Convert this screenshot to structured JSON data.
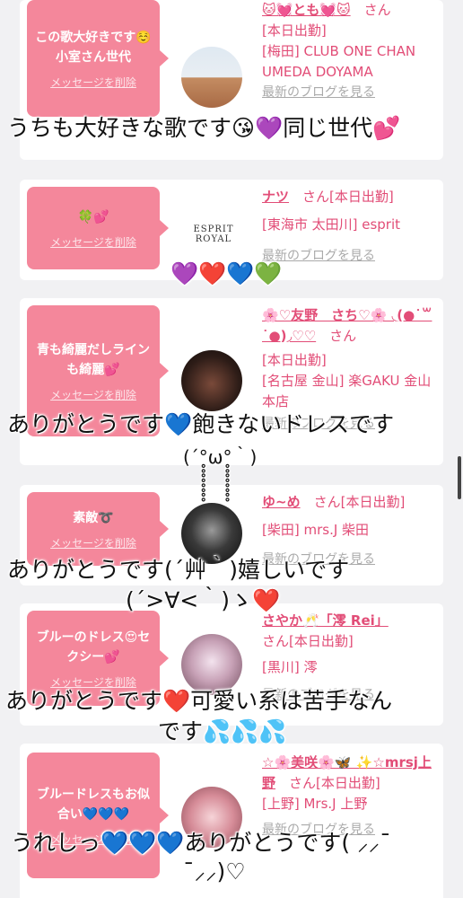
{
  "delete_label": "メッセージを削除",
  "blog_label": "最新のブログを見る",
  "san": "さん",
  "cards": [
    {
      "msg": "この歌大好きです☺️小室さん世代",
      "name": "🐱💓とも💓🐱",
      "status": "[本日出勤]",
      "shop": "[梅田] CLUB ONE CHAN UMEDA DOYAMA"
    },
    {
      "msg": "🍀💕",
      "name": "ナツ",
      "status": "[本日出勤]",
      "shop": "[東海市 太田川] esprit",
      "logo": "ESPRIT ROYAL"
    },
    {
      "msg": "青も綺麗だしラインも綺麗💕",
      "name": "🌸♡友野　さち♡🌸 ◟(●˙꒳˙●)◞♡♡",
      "status": "[本日出勤]",
      "shop": "[名古屋 金山] 楽GAKU 金山本店"
    },
    {
      "msg": "素敵➰",
      "name": "ゆ~め",
      "status": "[本日出勤]",
      "shop": "[柴田] mrs.J 柴田"
    },
    {
      "msg": "ブルーのドレス😍セクシー💕",
      "name": "さやか🥂「澪 Rei」",
      "status": "[本日出勤]",
      "shop": "[黒川] 澪"
    },
    {
      "msg": "ブルードレスもお似合い💙💙💙",
      "name": "☆🌸美咲🌸🦋 ✨☆mrsj上野",
      "status": "[本日出勤]",
      "shop": "[上野] Mrs.J 上野"
    }
  ],
  "replies": [
    "うちも大好きな歌です😘💜同じ世代💕",
    "💜❤️💙💚",
    "ありがとうです💙飽きないドレスです",
    "(´°̥̥̥̥̥̥̥̥ω°̥̥̥̥̥̥̥̥｀)",
    "ありがとうです(´艸｀)嬉しいです",
    "(´>∀<｀)ゝ❤️",
    "ありがとうです❤️可愛い系は苦手なん",
    "です💦💦💦",
    "うれしっ💙💙💙ありがとうです( ⸝⸝¯",
    "¯⸝⸝)♡"
  ]
}
